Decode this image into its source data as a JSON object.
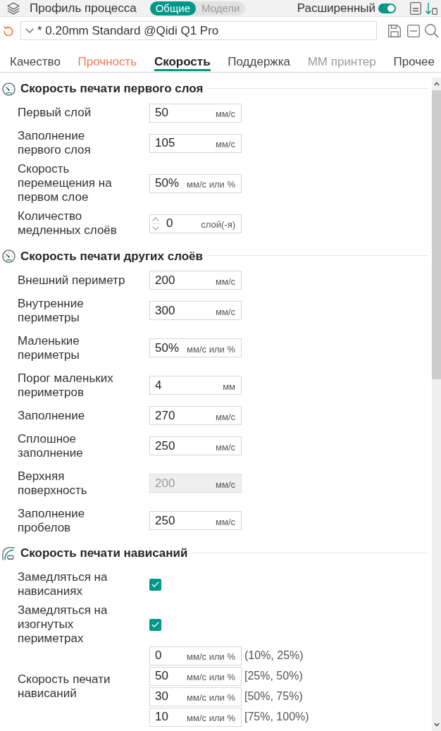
{
  "top_bar": {
    "title": "Профиль процесса",
    "mode_toggle": [
      {
        "label": "Общие",
        "selected": true
      },
      {
        "label": "Модели",
        "selected": false
      }
    ],
    "advanced": {
      "label": "Расширенный",
      "on": true
    }
  },
  "profile": {
    "name": "* 0.20mm Standard @Qidi Q1 Pro"
  },
  "tabs": [
    {
      "label": "Качество",
      "selected": false,
      "modified": false,
      "disabled": false
    },
    {
      "label": "Прочность",
      "selected": false,
      "modified": true,
      "disabled": false
    },
    {
      "label": "Скорость",
      "selected": true,
      "modified": false,
      "disabled": false
    },
    {
      "label": "Поддержка",
      "selected": false,
      "modified": false,
      "disabled": false
    },
    {
      "label": "ММ принтер",
      "selected": false,
      "modified": false,
      "disabled": true
    },
    {
      "label": "Прочее",
      "selected": false,
      "modified": false,
      "disabled": false
    }
  ],
  "sections": [
    {
      "title": "Скорость печати первого слоя",
      "kind": "gauge",
      "rows": [
        {
          "kind": "field",
          "label": "Первый слой",
          "value": "50",
          "unit": "мм/с",
          "disabled": false
        },
        {
          "kind": "field",
          "label": "Заполнение первого слоя",
          "value": "105",
          "unit": "мм/с",
          "disabled": false
        },
        {
          "kind": "field",
          "label": "Скорость перемещения на первом слое",
          "value": "50%",
          "unit": "мм/с или %",
          "disabled": false
        },
        {
          "kind": "spin",
          "label": "Количество медленных слоёв",
          "value": "0",
          "unit": "слой(-я)",
          "disabled": false
        }
      ]
    },
    {
      "title": "Скорость печати других слоёв",
      "kind": "gauge",
      "rows": [
        {
          "kind": "field",
          "label": "Внешний периметр",
          "value": "200",
          "unit": "мм/с",
          "disabled": false
        },
        {
          "kind": "field",
          "label": "Внутренние периметры",
          "value": "300",
          "unit": "мм/с",
          "disabled": false
        },
        {
          "kind": "field",
          "label": "Маленькие периметры",
          "value": "50%",
          "unit": "мм/с или %",
          "disabled": false
        },
        {
          "kind": "field",
          "label": "Порог маленьких периметров",
          "value": "4",
          "unit": "мм",
          "disabled": false
        },
        {
          "kind": "field",
          "label": "Заполнение",
          "value": "270",
          "unit": "мм/с",
          "disabled": false
        },
        {
          "kind": "field",
          "label": "Сплошное заполнение",
          "value": "250",
          "unit": "мм/с",
          "disabled": false
        },
        {
          "kind": "field",
          "label": "Верхняя поверхность",
          "value": "200",
          "unit": "мм/с",
          "disabled": true
        },
        {
          "kind": "field",
          "label": "Заполнение пробелов",
          "value": "250",
          "unit": "мм/с",
          "disabled": false
        }
      ]
    },
    {
      "title": "Скорость печати нависаний",
      "kind": "overhang",
      "rows": [
        {
          "kind": "checkbox",
          "label": "Замедляться на нависаниях",
          "checked": true
        },
        {
          "kind": "checkbox",
          "label": "Замедляться на изогнутых периметрах",
          "checked": true
        },
        {
          "kind": "ranges",
          "label": "Скорость печати нависаний",
          "fields": [
            {
              "value": "0",
              "unit": "мм/с или %",
              "range": "(10%, 25%)"
            },
            {
              "value": "50",
              "unit": "мм/с или %",
              "range": "[25%, 50%)"
            },
            {
              "value": "30",
              "unit": "мм/с или %",
              "range": "[50%, 75%)"
            },
            {
              "value": "10",
              "unit": "мм/с или %",
              "range": "[75%, 100%)"
            }
          ]
        }
      ]
    }
  ]
}
